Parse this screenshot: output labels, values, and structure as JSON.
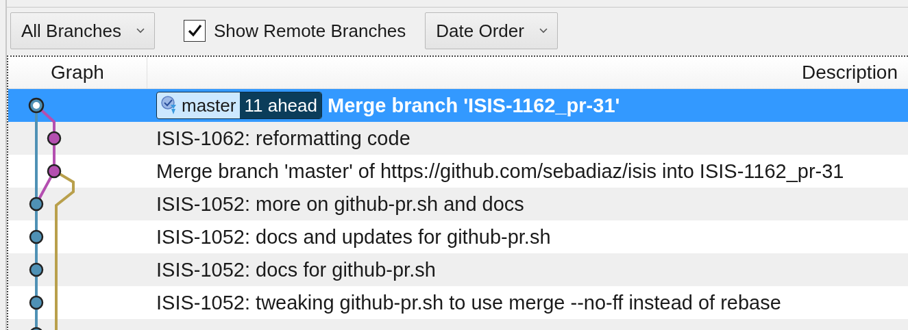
{
  "toolbar": {
    "branch_filter": {
      "value": "All Branches"
    },
    "show_remote": {
      "label": "Show Remote Branches",
      "checked": true
    },
    "order": {
      "value": "Date Order"
    }
  },
  "table": {
    "columns": [
      "Graph",
      "Description"
    ],
    "rows": [
      {
        "message": "Merge branch 'ISIS-1162_pr-31'",
        "selected": true,
        "branch": "master",
        "ahead": "11 ahead"
      },
      {
        "message": "ISIS-1062: reformatting code",
        "selected": false
      },
      {
        "message": "Merge branch 'master' of https://github.com/sebadiaz/isis into ISIS-1162_pr-31",
        "selected": false
      },
      {
        "message": "ISIS-1052: more on github-pr.sh and docs",
        "selected": false
      },
      {
        "message": "ISIS-1052: docs and updates for github-pr.sh",
        "selected": false
      },
      {
        "message": "ISIS-1052: docs for github-pr.sh",
        "selected": false
      },
      {
        "message": "ISIS-1052: tweaking github-pr.sh to use merge --no-ff instead of rebase",
        "selected": false
      }
    ]
  }
}
